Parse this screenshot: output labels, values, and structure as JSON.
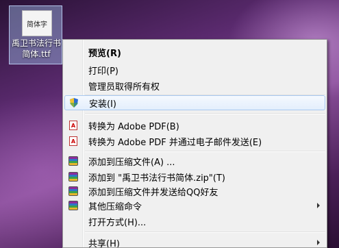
{
  "desktop_icon": {
    "thumb_text": "简体字",
    "label_line1": "禹卫书法行书",
    "label_line2": "简体.ttf"
  },
  "menu": {
    "items": [
      {
        "label": "预览(R)",
        "icon": ""
      },
      {
        "label": "打印(P)",
        "icon": ""
      },
      {
        "label": "管理员取得所有权",
        "icon": ""
      },
      {
        "label": "安装(I)",
        "icon": "shield-icon"
      },
      {
        "label": "转换为 Adobe PDF(B)",
        "icon": "pdf-icon"
      },
      {
        "label": "转换为 Adobe PDF 并通过电子邮件发送(E)",
        "icon": "pdf-mail-icon"
      },
      {
        "label": "添加到压缩文件(A) ...",
        "icon": "winrar-icon"
      },
      {
        "label": "添加到 \"禹卫书法行书简体.zip\"(T)",
        "icon": "winrar-icon"
      },
      {
        "label": "添加到压缩文件并发送给QQ好友",
        "icon": "winrar-icon"
      },
      {
        "label": "其他压缩命令",
        "icon": "winrar-icon"
      },
      {
        "label": "打开方式(H)...",
        "icon": ""
      },
      {
        "label": "共享(H)",
        "icon": ""
      }
    ]
  }
}
